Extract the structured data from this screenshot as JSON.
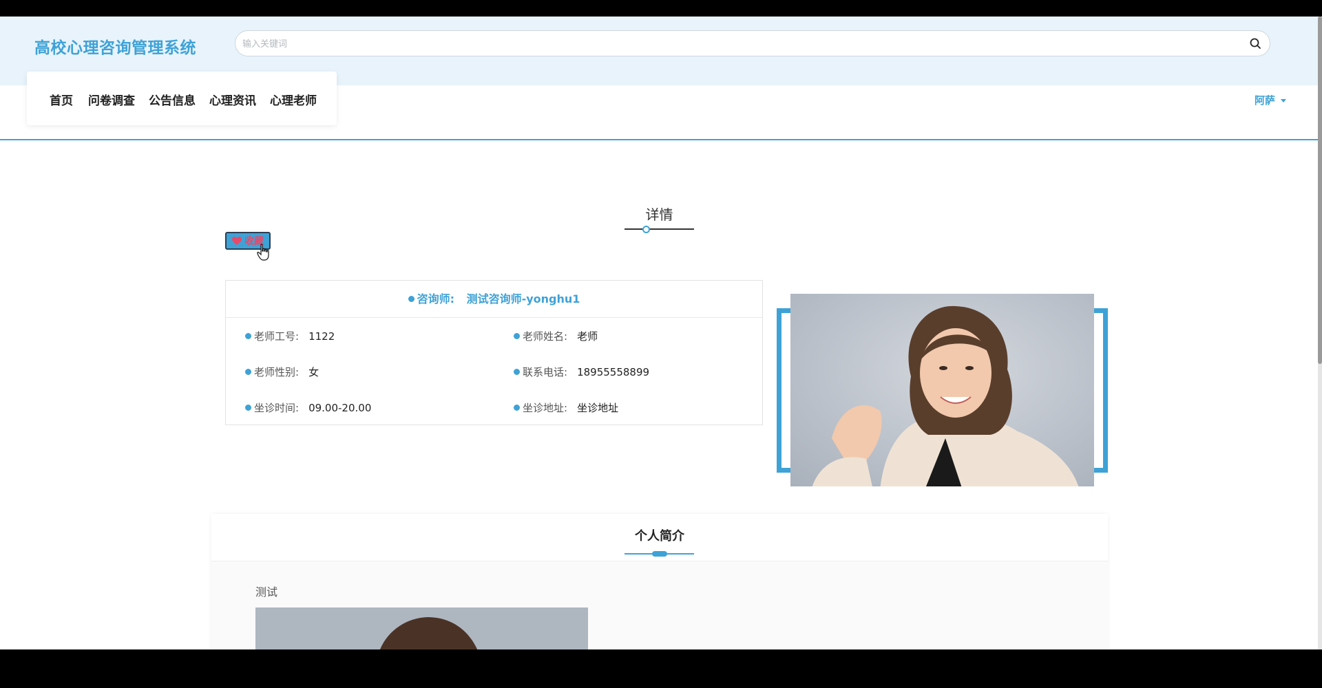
{
  "site": {
    "title": "高校心理咨询管理系统"
  },
  "search": {
    "placeholder": "输入关键词",
    "value": ""
  },
  "nav": {
    "items": [
      {
        "label": "首页"
      },
      {
        "label": "问卷调查"
      },
      {
        "label": "公告信息"
      },
      {
        "label": "心理资讯"
      },
      {
        "label": "心理老师"
      }
    ]
  },
  "user": {
    "name": "阿萨"
  },
  "detail": {
    "title": "详情",
    "favorite_label": "收藏",
    "consultant_label": "咨询师:",
    "consultant_name": "测试咨询师-yonghu1",
    "fields": [
      {
        "label": "老师工号:",
        "value": "1122"
      },
      {
        "label": "老师姓名:",
        "value": "老师"
      },
      {
        "label": "老师性别:",
        "value": "女"
      },
      {
        "label": "联系电话:",
        "value": "18955558899"
      },
      {
        "label": "坐诊时间:",
        "value": "09.00-20.00"
      },
      {
        "label": "坐诊地址:",
        "value": "坐诊地址"
      }
    ]
  },
  "intro": {
    "title": "个人简介",
    "text": "测试"
  },
  "colors": {
    "accent": "#3ea2d6",
    "favorite_text": "#e64a6a"
  },
  "icons": {
    "search": "search-icon",
    "favorite": "heart-icon",
    "caret": "caret-down-icon",
    "cursor": "hand-cursor-icon"
  }
}
